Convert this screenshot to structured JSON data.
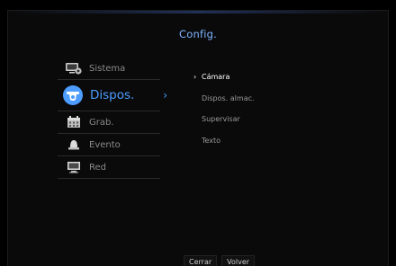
{
  "title": "Config.",
  "sidebar": {
    "items": [
      {
        "label": "Sistema",
        "icon": "system-settings-icon"
      },
      {
        "label": "Dispos.",
        "icon": "camera-device-icon",
        "active": true
      },
      {
        "label": "Grab.",
        "icon": "recording-calendar-icon"
      },
      {
        "label": "Evento",
        "icon": "event-alarm-icon"
      },
      {
        "label": "Red",
        "icon": "network-monitor-icon"
      }
    ]
  },
  "submenu": {
    "items": [
      {
        "label": "Cámara",
        "active": true
      },
      {
        "label": "Dispos. almac."
      },
      {
        "label": "Supervisar"
      },
      {
        "label": "Texto"
      }
    ]
  },
  "footer": {
    "close_label": "Cerrar",
    "back_label": "Volver"
  },
  "colors": {
    "accent": "#4d9cff",
    "title": "#7fb3ff",
    "background": "#0a0a0a"
  }
}
